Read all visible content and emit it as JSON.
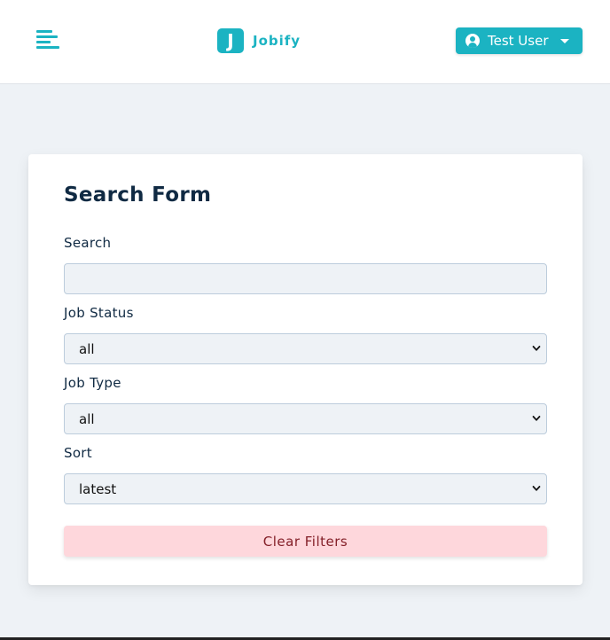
{
  "navbar": {
    "menu_icon": "menu-icon",
    "logo_letter": "J",
    "logo_text": "Jobify",
    "user_icon": "user-circle-icon",
    "user_name": "Test User",
    "caret_icon": "caret-down-icon"
  },
  "search_form": {
    "title": "Search Form",
    "search": {
      "label": "Search",
      "value": "",
      "placeholder": ""
    },
    "job_status": {
      "label": "Job Status",
      "selected": "all"
    },
    "job_type": {
      "label": "Job Type",
      "selected": "all"
    },
    "sort": {
      "label": "Sort",
      "selected": "latest"
    },
    "clear_button": "Clear Filters"
  },
  "colors": {
    "accent": "#1bb3c2",
    "page_background": "#eef2f6",
    "heading_text": "#102a43",
    "clear_button_bg": "#fed7dc",
    "clear_button_text": "#842029"
  }
}
